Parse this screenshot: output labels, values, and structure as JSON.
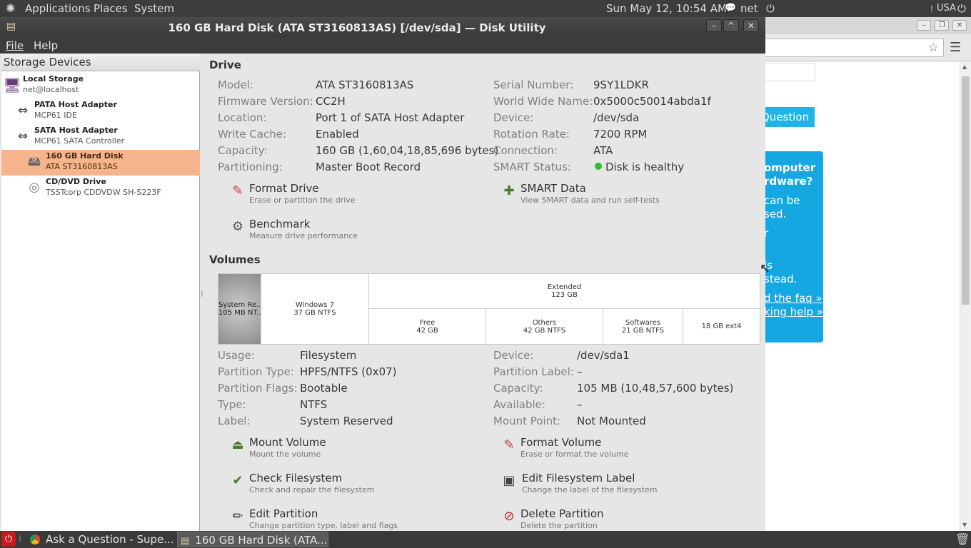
{
  "top_panel": {
    "applications": "Applications",
    "places": "Places",
    "system": "System",
    "datetime": "Sun May 12, 10:54 AM",
    "user": "net",
    "keyboard": "USA"
  },
  "window": {
    "title": "160 GB Hard Disk (ATA ST3160813AS) [/dev/sda] — Disk Utility",
    "menu_file": "File",
    "menu_help": "Help"
  },
  "sidebar": {
    "header": "Storage Devices",
    "devices": [
      {
        "name": "Local Storage",
        "sub": "net@localhost",
        "icon": "computer-icon"
      },
      {
        "name": "PATA Host Adapter",
        "sub": "MCP61 IDE",
        "icon": "host-adapter-icon"
      },
      {
        "name": "SATA Host Adapter",
        "sub": "MCP61 SATA Controller",
        "icon": "host-adapter-icon"
      },
      {
        "name": "160 GB Hard Disk",
        "sub": "ATA ST3160813AS",
        "icon": "hard-disk-icon"
      },
      {
        "name": "CD/DVD Drive",
        "sub": "TSSTcorp CDDVDW SH-S223F",
        "icon": "optical-drive-icon"
      }
    ]
  },
  "drive": {
    "section_title": "Drive",
    "left": [
      {
        "label": "Model:",
        "value": "ATA ST3160813AS"
      },
      {
        "label": "Firmware Version:",
        "value": "CC2H"
      },
      {
        "label": "Location:",
        "value": "Port 1 of SATA Host Adapter"
      },
      {
        "label": "Write Cache:",
        "value": "Enabled"
      },
      {
        "label": "Capacity:",
        "value": "160 GB (1,60,04,18,85,696 bytes)"
      },
      {
        "label": "Partitioning:",
        "value": "Master Boot Record"
      }
    ],
    "right": [
      {
        "label": "Serial Number:",
        "value": "9SY1LDKR"
      },
      {
        "label": "World Wide Name:",
        "value": "0x5000c50014abda1f"
      },
      {
        "label": "Device:",
        "value": "/dev/sda"
      },
      {
        "label": "Rotation Rate:",
        "value": "7200 RPM"
      },
      {
        "label": "Connection:",
        "value": "ATA"
      },
      {
        "label": "SMART Status:",
        "value": "Disk is healthy"
      }
    ],
    "actions": [
      {
        "title": "Format Drive",
        "desc": "Erase or partition the drive",
        "icon": "format-drive-icon"
      },
      {
        "title": "SMART Data",
        "desc": "View SMART data and run self-tests",
        "icon": "smart-data-icon"
      },
      {
        "title": "Benchmark",
        "desc": "Measure drive performance",
        "icon": "benchmark-icon"
      }
    ],
    "status_color": "#2fbe2f"
  },
  "volumes": {
    "section_title": "Volumes",
    "map": {
      "system_reserved": {
        "line1": "System Re...",
        "line2": "105 MB NT..."
      },
      "windows7": {
        "line1": "Windows 7",
        "line2": "37 GB NTFS"
      },
      "extended": {
        "line1": "Extended",
        "line2": "123 GB"
      },
      "free": {
        "line1": "Free",
        "line2": "42 GB"
      },
      "others": {
        "line1": "Others",
        "line2": "42 GB NTFS"
      },
      "softwares": {
        "line1": "Softwares",
        "line2": "21 GB NTFS"
      },
      "ext4": {
        "line1": "18 GB ext4"
      }
    },
    "left": [
      {
        "label": "Usage:",
        "value": "Filesystem"
      },
      {
        "label": "Partition Type:",
        "value": "HPFS/NTFS (0x07)"
      },
      {
        "label": "Partition Flags:",
        "value": "Bootable"
      },
      {
        "label": "Type:",
        "value": "NTFS"
      },
      {
        "label": "Label:",
        "value": "System Reserved"
      }
    ],
    "right": [
      {
        "label": "Device:",
        "value": "/dev/sda1"
      },
      {
        "label": "Partition Label:",
        "value": "–"
      },
      {
        "label": "Capacity:",
        "value": "105 MB (10,48,57,600 bytes)"
      },
      {
        "label": "Available:",
        "value": "–"
      },
      {
        "label": "Mount Point:",
        "value": "Not Mounted"
      }
    ],
    "actions": [
      {
        "title": "Mount Volume",
        "desc": "Mount the volume",
        "icon": "mount-icon"
      },
      {
        "title": "Format Volume",
        "desc": "Erase or format the volume",
        "icon": "format-volume-icon"
      },
      {
        "title": "Check Filesystem",
        "desc": "Check and repair the filesystem",
        "icon": "check-filesystem-icon"
      },
      {
        "title": "Edit Filesystem Label",
        "desc": "Change the label of the filesystem",
        "icon": "edit-label-icon"
      },
      {
        "title": "Edit Partition",
        "desc": "Change partition type, label and flags",
        "icon": "edit-partition-icon"
      },
      {
        "title": "Delete Partition",
        "desc": "Delete the partition",
        "icon": "delete-partition-icon"
      }
    ]
  },
  "browser": {
    "ask_button": "Question",
    "panel_lines": [
      "omputer",
      "rdware?",
      "can be",
      "sed.",
      "r",
      "is",
      "stead."
    ],
    "panel_links": [
      "d the faq »",
      "king help »"
    ],
    "accent": "#15a7e2"
  },
  "taskbar": {
    "task1": "Ask a Question - Supe...",
    "task2": "160 GB Hard Disk (ATA..."
  }
}
